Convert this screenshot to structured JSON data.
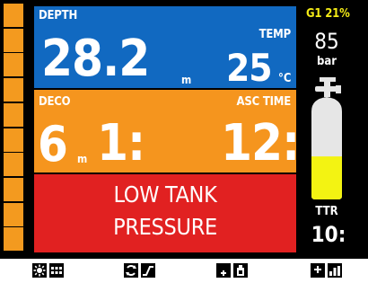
{
  "depth": {
    "label": "DEPTH",
    "value": "28.2",
    "unit": "m"
  },
  "temperature": {
    "label": "TEMP",
    "value": "25",
    "unit": "°C"
  },
  "deco": {
    "label": "DECO",
    "stop_depth": "6",
    "stop_depth_unit": "m",
    "stop_time": "1:"
  },
  "ascent_time": {
    "label": "ASC TIME",
    "value": "12:"
  },
  "alert": {
    "line1": "LOW TANK",
    "line2": "PRESSURE"
  },
  "gas": {
    "label": "G1 21%"
  },
  "tank_pressure": {
    "value": "85",
    "unit": "bar",
    "fill_fraction": 0.42
  },
  "ttr": {
    "label": "TTR",
    "value": "10:"
  },
  "ascent_rate": {
    "segments": 10
  },
  "colors": {
    "depth_panel": "#1169c1",
    "deco_panel": "#f5951e",
    "alert_panel": "#e12121",
    "gas_text": "#f3ea16",
    "tank_fill": "#f3f312",
    "tank_empty": "#e6e6e6"
  },
  "buttons": [
    {
      "icons": [
        "brightness-icon",
        "grid-menu-icon"
      ]
    },
    {
      "icons": [
        "gas-switch-icon",
        "profile-graph-icon"
      ]
    },
    {
      "icons": [
        "plus-icon",
        "compass-icon"
      ]
    },
    {
      "icons": [
        "plus-icon",
        "bar-chart-icon"
      ]
    }
  ]
}
